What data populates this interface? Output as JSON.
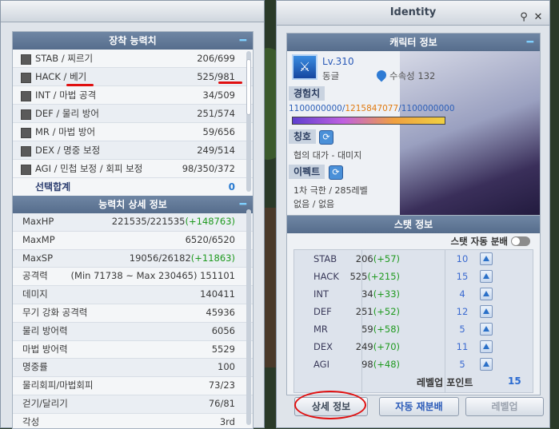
{
  "right_window": {
    "title": "Identity",
    "character": {
      "header": "캐릭터 정보",
      "level": "Lv.310",
      "guild": "동글",
      "element": "수속성 132",
      "exp_label": "경험치",
      "exp_current": "1100000000",
      "exp_gain": "1215847077",
      "exp_max": "1100000000",
      "exp_separator": "/",
      "title_label": "칭호",
      "title_value": "협의 대가 - 대미지",
      "effect_label": "이펙트",
      "effect_value_1": "1차 극한 / 285레벨",
      "effect_value_2": "없음 / 없음"
    },
    "stats": {
      "header": "스탯 정보",
      "auto_distribute": "스탯 자동 분배",
      "rows": [
        {
          "name": "STAB",
          "base": "206",
          "bonus": "(+57)",
          "cost": "10"
        },
        {
          "name": "HACK",
          "base": "525",
          "bonus": "(+215)",
          "cost": "15"
        },
        {
          "name": "INT",
          "base": "34",
          "bonus": "(+33)",
          "cost": "4"
        },
        {
          "name": "DEF",
          "base": "251",
          "bonus": "(+52)",
          "cost": "12"
        },
        {
          "name": "MR",
          "base": "59",
          "bonus": "(+58)",
          "cost": "5"
        },
        {
          "name": "DEX",
          "base": "249",
          "bonus": "(+70)",
          "cost": "11"
        },
        {
          "name": "AGI",
          "base": "98",
          "bonus": "(+48)",
          "cost": "5"
        }
      ],
      "levelup_points_label": "레벨업 포인트",
      "levelup_points": "15"
    },
    "buttons": {
      "detail": "상세 정보",
      "auto_redistribute": "자동 재분배",
      "levelup": "레벨업"
    }
  },
  "left_window": {
    "equip_header": "장착 능력치",
    "equip_rows": [
      {
        "name": "STAB / 찌르기",
        "value": "206/699"
      },
      {
        "name": "HACK / 베기",
        "value": "525/981"
      },
      {
        "name": "INT / 마법 공격",
        "value": "34/509"
      },
      {
        "name": "DEF / 물리 방어",
        "value": "251/574"
      },
      {
        "name": "MR / 마법 방어",
        "value": "59/656"
      },
      {
        "name": "DEX / 명중 보정",
        "value": "249/514"
      },
      {
        "name": "AGI / 민첩 보정 / 회피 보정",
        "value": "98/350/372"
      }
    ],
    "selected_sum_label": "선택합계",
    "selected_sum_value": "0",
    "detail_header": "능력치 상세 정보",
    "detail_rows": [
      {
        "name": "MaxHP",
        "value": "221535/221535",
        "bonus": "(+148763)"
      },
      {
        "name": "MaxMP",
        "value": "6520/6520",
        "bonus": ""
      },
      {
        "name": "MaxSP",
        "value": "19056/26182",
        "bonus": "(+11863)"
      },
      {
        "name": "공격력",
        "value": "(Min 71738 ~ Max 230465)  151101",
        "bonus": ""
      },
      {
        "name": "데미지",
        "value": "140411",
        "bonus": ""
      },
      {
        "name": "무기 강화 공격력",
        "value": "45936",
        "bonus": ""
      },
      {
        "name": "물리 방어력",
        "value": "6056",
        "bonus": ""
      },
      {
        "name": "마법 방어력",
        "value": "5529",
        "bonus": ""
      },
      {
        "name": "명중률",
        "value": "100",
        "bonus": ""
      },
      {
        "name": "물리회피/마법회피",
        "value": "73/23",
        "bonus": ""
      },
      {
        "name": "걷기/달리기",
        "value": "76/81",
        "bonus": ""
      },
      {
        "name": "각성",
        "value": "3rd",
        "bonus": ""
      }
    ]
  },
  "colors": {
    "accent": "#2a5ab8",
    "bonus_green": "#1f9a1f",
    "highlight_red": "#e01010"
  }
}
